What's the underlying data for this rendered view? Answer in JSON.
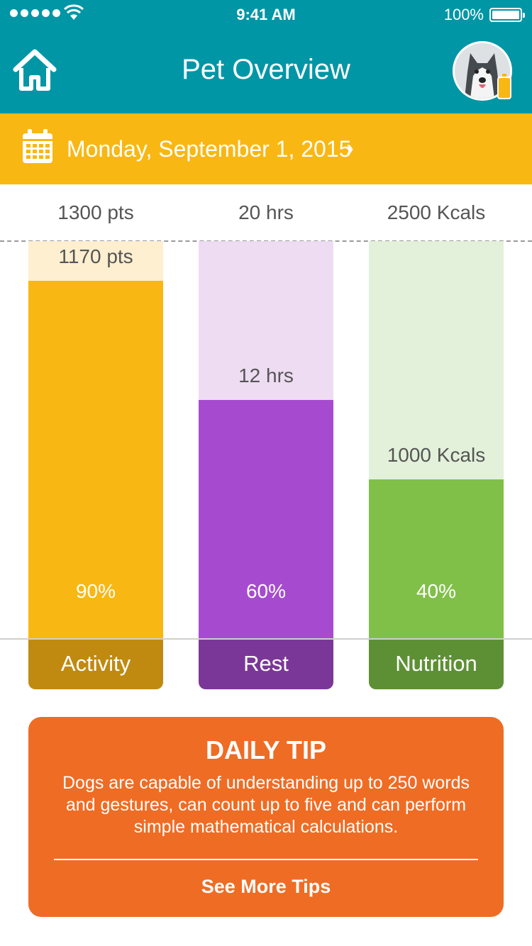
{
  "status_bar": {
    "time": "9:41 AM",
    "battery": "100%"
  },
  "header": {
    "title": "Pet Overview",
    "home_icon": "home-icon",
    "avatar": "husky-avatar"
  },
  "date_bar": {
    "date": "Monday, September 1, 2015",
    "chevron": "›"
  },
  "colors": {
    "teal": "#0096a6",
    "yellow": "#f9b713",
    "orange": "#ef6c24",
    "activity": "#f9b713",
    "activity_light": "#fdefd0",
    "activity_dark": "#c08a10",
    "rest": "#a64bd0",
    "rest_light": "#eedcf3",
    "rest_dark": "#7b3798",
    "nutrition": "#80c049",
    "nutrition_light": "#e3f1da",
    "nutrition_dark": "#5d9035"
  },
  "chart_data": {
    "type": "bar",
    "categories": [
      "Activity",
      "Rest",
      "Nutrition"
    ],
    "series": [
      {
        "name": "Activity",
        "goal": "1300 pts",
        "value": "1170 pts",
        "percent": "90%",
        "fraction": 0.9
      },
      {
        "name": "Rest",
        "goal": "20 hrs",
        "value": "12 hrs",
        "percent": "60%",
        "fraction": 0.6
      },
      {
        "name": "Nutrition",
        "goal": "2500 Kcals",
        "value": "1000 Kcals",
        "percent": "40%",
        "fraction": 0.4
      }
    ]
  },
  "tip": {
    "title": "DAILY TIP",
    "body": "Dogs are capable of understanding up to 250 words and gestures, can count up to five and can perform simple mathematical calculations.",
    "link": "See More Tips"
  }
}
